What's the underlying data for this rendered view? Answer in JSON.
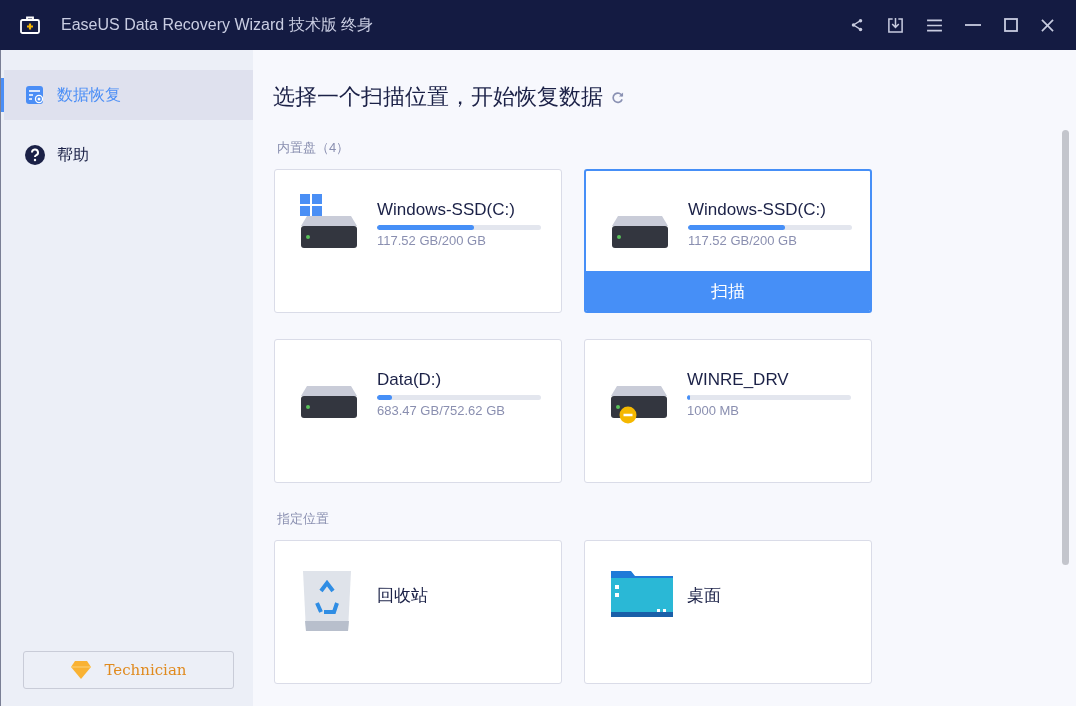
{
  "window": {
    "title": "EaseUS Data Recovery Wizard 技术版 终身"
  },
  "sidebar": {
    "items": [
      {
        "label": "数据恢复",
        "kind": "recovery",
        "selected": true
      },
      {
        "label": "帮助",
        "kind": "help",
        "selected": false
      }
    ],
    "upgrade_button": "Technician"
  },
  "main": {
    "heading": "选择一个扫描位置，开始恢复数据",
    "sections": [
      {
        "label": "内置盘（4）",
        "kind": "drives",
        "items": [
          {
            "name": "Windows-SSD(C:)",
            "size": "117.52 GB/200 GB",
            "level": 0.59,
            "system": true,
            "warning": false,
            "selected": false
          },
          {
            "name": "Windows-SSD(C:)",
            "size": "117.52 GB/200 GB",
            "level": 0.59,
            "system": false,
            "warning": false,
            "selected": true
          },
          {
            "name": "Data(D:)",
            "size": "683.47 GB/752.62 GB",
            "level": 0.09,
            "system": false,
            "warning": false,
            "selected": false
          },
          {
            "name": "WINRE_DRV",
            "size": "1000 MB",
            "level": 0.02,
            "system": false,
            "warning": true,
            "selected": false
          }
        ]
      },
      {
        "label": "指定位置",
        "kind": "locations",
        "items": [
          {
            "name": "回收站",
            "kind": "recycle_bin",
            "selected": false
          },
          {
            "name": "桌面",
            "kind": "desktop",
            "selected": false
          }
        ]
      }
    ],
    "scan_button": "扫描"
  }
}
